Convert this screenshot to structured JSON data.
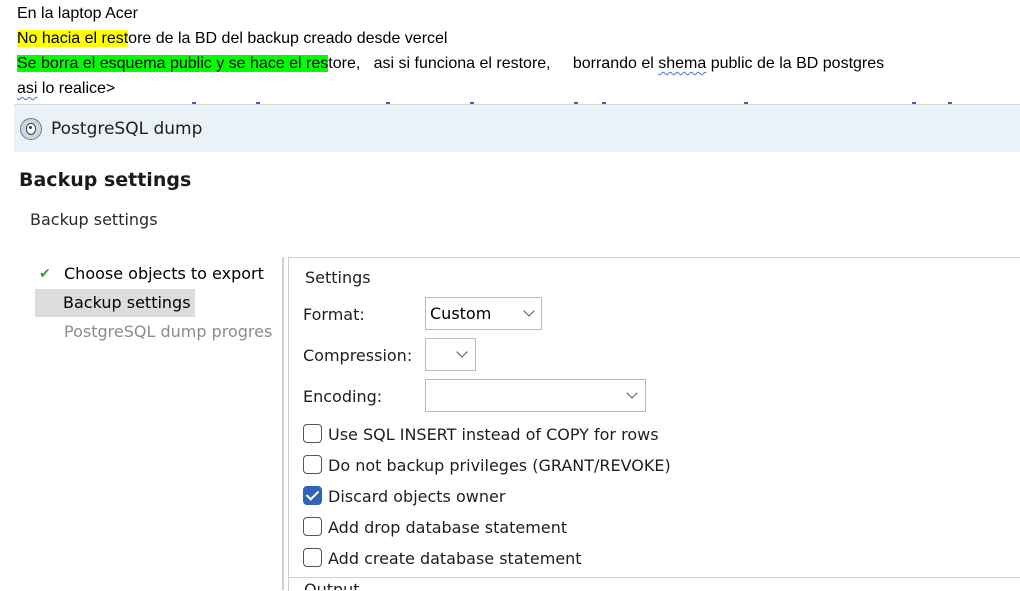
{
  "notes": {
    "line1": "En la laptop Acer",
    "line2_highlight": "No hacia el rest",
    "line2_rest": "ore de la BD del backup creado desde vercel",
    "line3_highlight": "Se borra el esquema public  y se hace el res",
    "line3_part1": "tore,   asi si funciona el restore,     borrando el ",
    "line3_squiggle": "shema",
    "line3_part2": " public de la BD postgres",
    "line4_squiggle": "asi",
    "line4_rest": " lo realice>"
  },
  "window": {
    "icon": "postgresql-elephant-icon",
    "title": "PostgreSQL dump"
  },
  "page": {
    "heading": "Backup settings",
    "subheading": "Backup settings"
  },
  "nav": {
    "items": [
      {
        "label": "Choose objects to export",
        "state": "done",
        "icon": "checkmark-icon"
      },
      {
        "label": "Backup settings",
        "state": "selected"
      },
      {
        "label": "PostgreSQL dump progres",
        "state": "disabled"
      }
    ]
  },
  "settings": {
    "group_title": "Settings",
    "format_label": "Format:",
    "format_value": "Custom",
    "compression_label": "Compression:",
    "compression_value": "",
    "encoding_label": "Encoding:",
    "encoding_value": "",
    "checkboxes": [
      {
        "label": "Use SQL INSERT instead of COPY for rows",
        "checked": false
      },
      {
        "label": "Do not backup privileges (GRANT/REVOKE)",
        "checked": false
      },
      {
        "label": "Discard objects owner",
        "checked": true
      },
      {
        "label": "Add drop database statement",
        "checked": false
      },
      {
        "label": "Add create database statement",
        "checked": false
      }
    ],
    "next_group_title": "Output"
  },
  "colors": {
    "highlight_yellow": "#ffff00",
    "highlight_green": "#00ff00",
    "titlebar_bg": "#eaf2f8",
    "checkbox_checked": "#2f63b8",
    "nav_selected_bg": "#dcdcdc"
  }
}
